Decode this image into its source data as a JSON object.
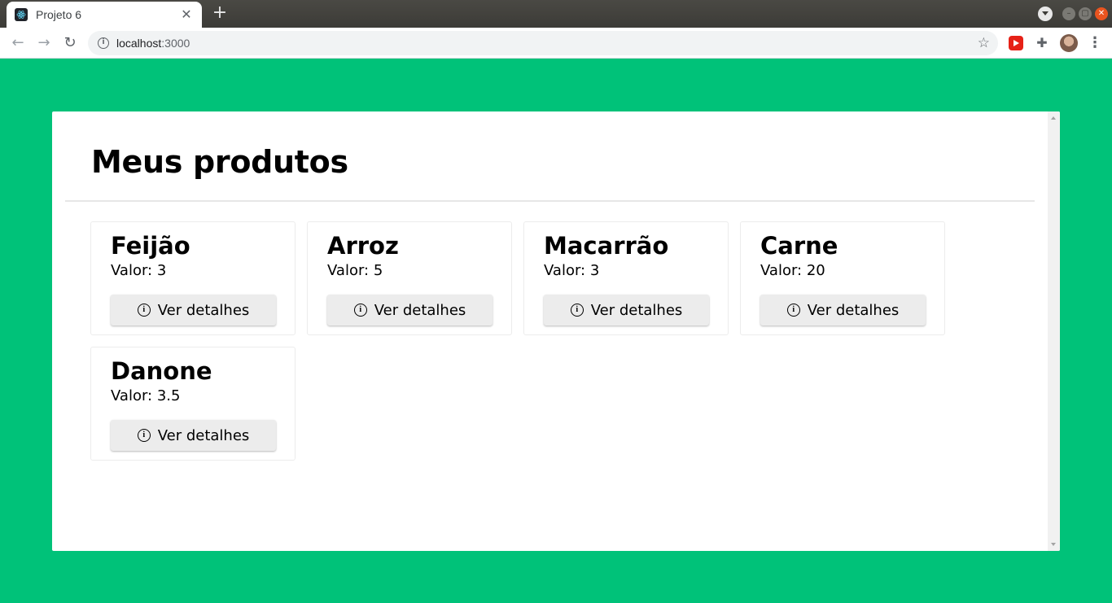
{
  "browser": {
    "tab_title": "Projeto 6",
    "url_host": "localhost",
    "url_port": ":3000"
  },
  "page": {
    "title": "Meus produtos",
    "products": [
      {
        "name": "Feijão",
        "value_text": "Valor: 3",
        "button_label": "Ver detalhes"
      },
      {
        "name": "Arroz",
        "value_text": "Valor: 5",
        "button_label": "Ver detalhes"
      },
      {
        "name": "Macarrão",
        "value_text": "Valor: 3",
        "button_label": "Ver detalhes"
      },
      {
        "name": "Carne",
        "value_text": "Valor: 20",
        "button_label": "Ver detalhes"
      },
      {
        "name": "Danone",
        "value_text": "Valor: 3.5",
        "button_label": "Ver detalhes"
      }
    ]
  },
  "colors": {
    "background": "#00c279",
    "button_bg": "#ececec"
  }
}
